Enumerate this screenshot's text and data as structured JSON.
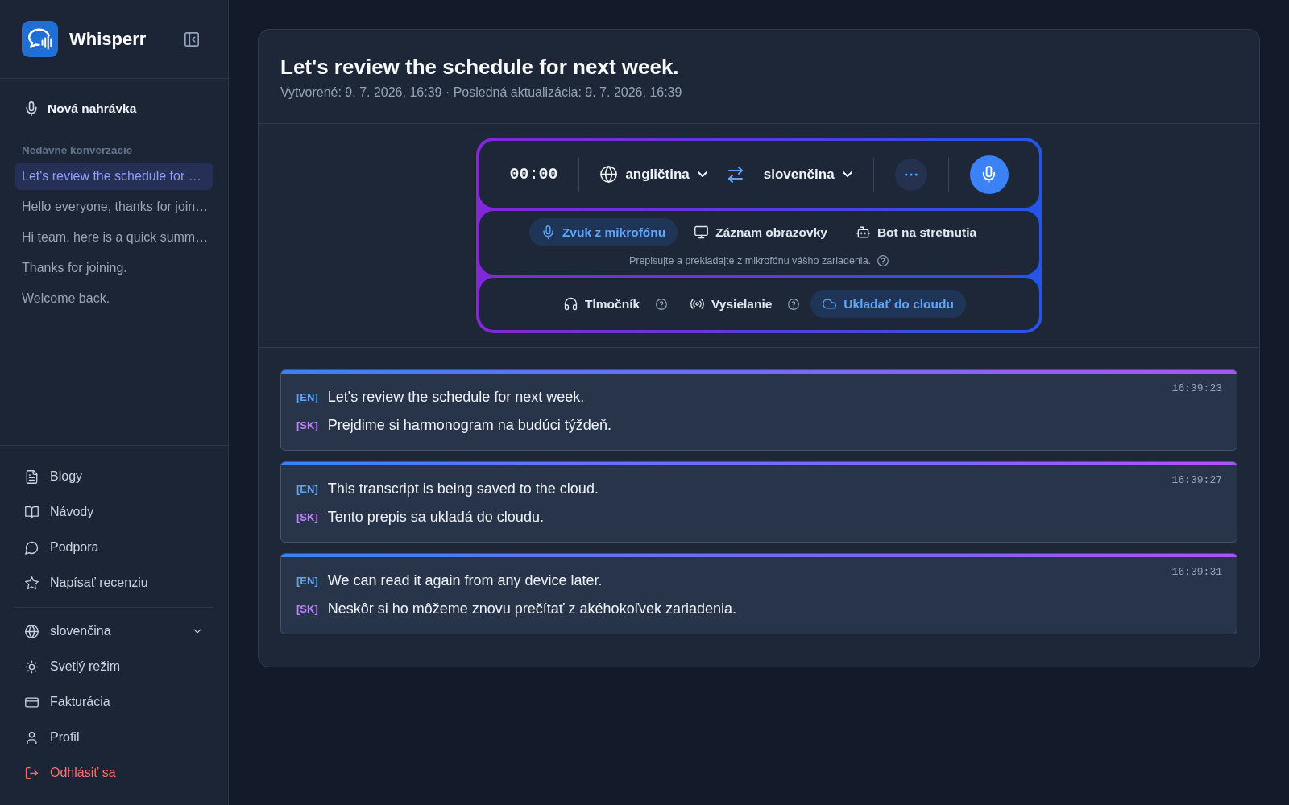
{
  "sidebar": {
    "brand": "Whisperr",
    "new_recording": "Nová nahrávka",
    "recent_heading": "Nedávne konverzácie",
    "conversations": [
      {
        "title": "Let's review the schedule for …",
        "selected": true
      },
      {
        "title": "Hello everyone, thanks for join…",
        "selected": false
      },
      {
        "title": "Hi team, here is a quick summ…",
        "selected": false
      },
      {
        "title": "Thanks for joining.",
        "selected": false
      },
      {
        "title": "Welcome back.",
        "selected": false
      }
    ],
    "links": [
      {
        "label": "Blogy"
      },
      {
        "label": "Návody"
      },
      {
        "label": "Podpora"
      },
      {
        "label": "Napísať recenziu"
      }
    ],
    "settings": [
      {
        "kind": "dropdown",
        "label": "slovenčina"
      },
      {
        "kind": "link",
        "label": "Svetlý režim"
      },
      {
        "kind": "link",
        "label": "Fakturácia"
      },
      {
        "kind": "link",
        "label": "Profil"
      },
      {
        "kind": "danger",
        "label": "Odhlásiť sa"
      }
    ]
  },
  "conversation": {
    "title": "Let's review the schedule for next week.",
    "meta": "Vytvorené: 9. 7. 2026, 16:39 · Posledná aktualizácia: 9. 7. 2026, 16:39"
  },
  "recorder": {
    "timer": "00:00",
    "source_language": "angličtina",
    "target_language": "slovenčina",
    "input_modes": [
      {
        "label": "Zvuk z mikrofónu",
        "selected": true
      },
      {
        "label": "Záznam obrazovky",
        "selected": false
      },
      {
        "label": "Bot na stretnutia",
        "selected": false
      }
    ],
    "mode_hint": "Prepisujte a prekladajte z mikrofónu vášho zariadenia.",
    "options": [
      {
        "label": "Tlmočník",
        "on": false,
        "help": true
      },
      {
        "label": "Vysielanie",
        "on": false,
        "help": true
      },
      {
        "label": "Ukladať do cloudu",
        "on": true,
        "help": false
      }
    ]
  },
  "transcript": [
    {
      "time": "16:39:23",
      "lines": [
        {
          "tag": "[EN]",
          "color": "#60a5fa",
          "text": "Let's review the schedule for next week."
        },
        {
          "tag": "[SK]",
          "color": "#c084fc",
          "text": "Prejdime si harmonogram na budúci týždeň."
        }
      ]
    },
    {
      "time": "16:39:27",
      "lines": [
        {
          "tag": "[EN]",
          "color": "#60a5fa",
          "text": "This transcript is being saved to the cloud."
        },
        {
          "tag": "[SK]",
          "color": "#c084fc",
          "text": "Tento prepis sa ukladá do cloudu."
        }
      ]
    },
    {
      "time": "16:39:31",
      "lines": [
        {
          "tag": "[EN]",
          "color": "#60a5fa",
          "text": "We can read it again from any device later."
        },
        {
          "tag": "[SK]",
          "color": "#c084fc",
          "text": "Neskôr si ho môžeme znovu prečítať z akéhokoľvek zariadenia."
        }
      ]
    }
  ]
}
